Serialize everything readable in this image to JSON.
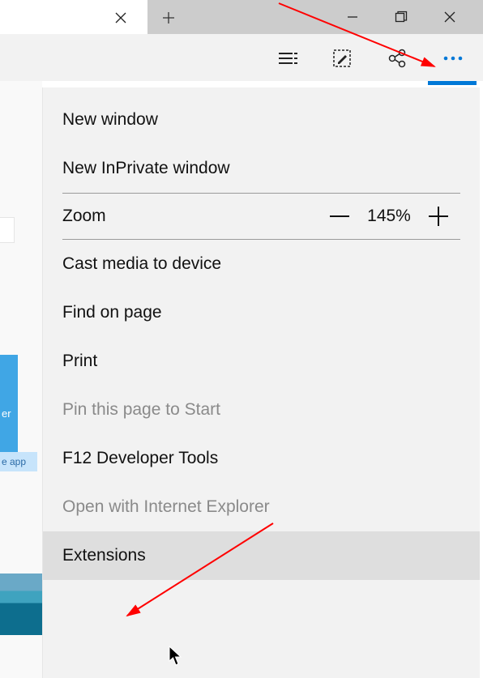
{
  "sidebar_fragment": {
    "tile1_text": "er",
    "tile2_text": "e app"
  },
  "toolbar": {
    "icons": {
      "reading": "reading-view-icon",
      "hub": "web-note-icon",
      "share": "share-icon",
      "more": "more-icon"
    }
  },
  "menu": {
    "new_window": "New window",
    "new_inprivate": "New InPrivate window",
    "zoom_label": "Zoom",
    "zoom_value": "145%",
    "cast": "Cast media to device",
    "find": "Find on page",
    "print": "Print",
    "pin": "Pin this page to Start",
    "devtools": "F12 Developer Tools",
    "open_ie": "Open with Internet Explorer",
    "extensions": "Extensions"
  }
}
